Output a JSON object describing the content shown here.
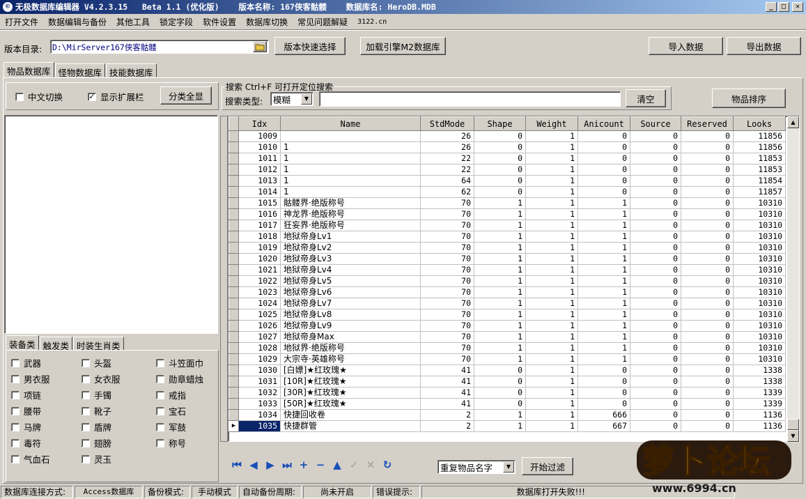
{
  "window": {
    "title": "无极数据库编辑器 V4.2.3.15   Beta 1.1 (优化版)    版本名称: 167侠客骷髅    数据库名: HeroDB.MDB",
    "controls": [
      "_",
      "□",
      "✕"
    ]
  },
  "menu": [
    "打开文件",
    "数据编辑与备份",
    "其他工具",
    "锁定字段",
    "软件设置",
    "数据库切换",
    "常见问题解疑",
    "3122.cn"
  ],
  "toolbar": {
    "version_dir_label": "版本目录:",
    "version_dir_value": "D:\\MirServer167侠客骷髅",
    "quick_select": "版本快速选择",
    "load_m2": "加载引擎M2数据库",
    "import": "导入数据",
    "export": "导出数据"
  },
  "tabs": [
    "物品数据库",
    "怪物数据库",
    "技能数据库"
  ],
  "options": {
    "chinese_switch": "中文切换",
    "show_ext": "显示扩展栏",
    "show_all": "分类全显",
    "show_ext_checked": true
  },
  "search": {
    "group_title": "搜索  Ctrl+F 可打开定位搜索",
    "type_label": "搜索类型:",
    "type_value": "模糊",
    "query": "",
    "clear": "清空",
    "sort": "物品排序"
  },
  "category_tabs": [
    "装备类",
    "触发类",
    "时装生肖类"
  ],
  "categories": [
    [
      "武器",
      "头盔",
      "斗笠面巾"
    ],
    [
      "男衣服",
      "女衣服",
      "勋章蜡烛"
    ],
    [
      "项链",
      "手镯",
      "戒指"
    ],
    [
      "腰带",
      "靴子",
      "宝石"
    ],
    [
      "马牌",
      "盾牌",
      "军鼓"
    ],
    [
      "毒符",
      "翅膀",
      "称号"
    ],
    [
      "气血石",
      "灵玉",
      ""
    ]
  ],
  "grid": {
    "columns": [
      "Idx",
      "Name",
      "StdMode",
      "Shape",
      "Weight",
      "Anicount",
      "Source",
      "Reserved",
      "Looks"
    ],
    "rows": [
      [
        "1009",
        "",
        "26",
        "0",
        "1",
        "0",
        "0",
        "0",
        "11856"
      ],
      [
        "1010",
        "1",
        "26",
        "0",
        "1",
        "0",
        "0",
        "0",
        "11856"
      ],
      [
        "1011",
        "1",
        "22",
        "0",
        "1",
        "0",
        "0",
        "0",
        "11853"
      ],
      [
        "1012",
        "1",
        "22",
        "0",
        "1",
        "0",
        "0",
        "0",
        "11853"
      ],
      [
        "1013",
        "1",
        "64",
        "0",
        "1",
        "0",
        "0",
        "0",
        "11854"
      ],
      [
        "1014",
        "1",
        "62",
        "0",
        "1",
        "0",
        "0",
        "0",
        "11857"
      ],
      [
        "1015",
        "骷髅界·绝版称号",
        "70",
        "1",
        "1",
        "1",
        "0",
        "0",
        "10310"
      ],
      [
        "1016",
        "神龙界·绝版称号",
        "70",
        "1",
        "1",
        "1",
        "0",
        "0",
        "10310"
      ],
      [
        "1017",
        "狂妄界·绝版称号",
        "70",
        "1",
        "1",
        "1",
        "0",
        "0",
        "10310"
      ],
      [
        "1018",
        "地狱帝身Lv1",
        "70",
        "1",
        "1",
        "1",
        "0",
        "0",
        "10310"
      ],
      [
        "1019",
        "地狱帝身Lv2",
        "70",
        "1",
        "1",
        "1",
        "0",
        "0",
        "10310"
      ],
      [
        "1020",
        "地狱帝身Lv3",
        "70",
        "1",
        "1",
        "1",
        "0",
        "0",
        "10310"
      ],
      [
        "1021",
        "地狱帝身Lv4",
        "70",
        "1",
        "1",
        "1",
        "0",
        "0",
        "10310"
      ],
      [
        "1022",
        "地狱帝身Lv5",
        "70",
        "1",
        "1",
        "1",
        "0",
        "0",
        "10310"
      ],
      [
        "1023",
        "地狱帝身Lv6",
        "70",
        "1",
        "1",
        "1",
        "0",
        "0",
        "10310"
      ],
      [
        "1024",
        "地狱帝身Lv7",
        "70",
        "1",
        "1",
        "1",
        "0",
        "0",
        "10310"
      ],
      [
        "1025",
        "地狱帝身Lv8",
        "70",
        "1",
        "1",
        "1",
        "0",
        "0",
        "10310"
      ],
      [
        "1026",
        "地狱帝身Lv9",
        "70",
        "1",
        "1",
        "1",
        "0",
        "0",
        "10310"
      ],
      [
        "1027",
        "地狱帝身Max",
        "70",
        "1",
        "1",
        "1",
        "0",
        "0",
        "10310"
      ],
      [
        "1028",
        "地狱界·绝版称号",
        "70",
        "1",
        "1",
        "1",
        "0",
        "0",
        "10310"
      ],
      [
        "1029",
        "大宗寺·英雄称号",
        "70",
        "1",
        "1",
        "1",
        "0",
        "0",
        "10310"
      ],
      [
        "1030",
        "[白嫖]★红玫瑰★",
        "41",
        "0",
        "1",
        "0",
        "0",
        "0",
        "1338"
      ],
      [
        "1031",
        "[10R]★红玫瑰★",
        "41",
        "0",
        "1",
        "0",
        "0",
        "0",
        "1338"
      ],
      [
        "1032",
        "[30R]★红玫瑰★",
        "41",
        "0",
        "1",
        "0",
        "0",
        "0",
        "1339"
      ],
      [
        "1033",
        "[50R]★红玫瑰★",
        "41",
        "0",
        "1",
        "0",
        "0",
        "0",
        "1339"
      ],
      [
        "1034",
        "快捷回收卷",
        "2",
        "1",
        "1",
        "666",
        "0",
        "0",
        "1136"
      ],
      [
        "1035",
        "快捷群管",
        "2",
        "1",
        "1",
        "667",
        "0",
        "0",
        "1136"
      ]
    ]
  },
  "bottom": {
    "filter_select": "重复物品名字",
    "start_filter": "开始过滤"
  },
  "status": [
    "数据库连接方式:",
    "Access数据库",
    "备份模式:",
    "手动模式",
    "自动备份周期:",
    "尚未开启",
    "错误提示:",
    "数据库打开失败!!!"
  ],
  "watermark": {
    "text": "萝卜论坛",
    "url": "www.6994.cn"
  }
}
